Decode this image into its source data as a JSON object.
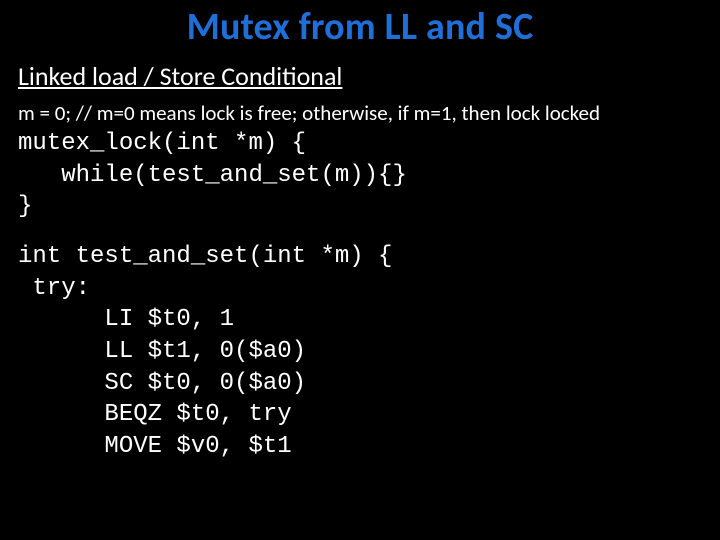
{
  "title": "Mutex from LL and SC",
  "subtitle": "Linked load / Store Conditional",
  "comment": "m = 0; // m=0 means lock is free; otherwise, if m=1, then lock locked",
  "code1": "mutex_lock(int *m) {\n   while(test_and_set(m)){}\n}",
  "code2": "int test_and_set(int *m) {\n try:\n      LI $t0, 1\n      LL $t1, 0($a0)\n      SC $t0, 0($a0)\n      BEQZ $t0, try\n      MOVE $v0, $t1"
}
